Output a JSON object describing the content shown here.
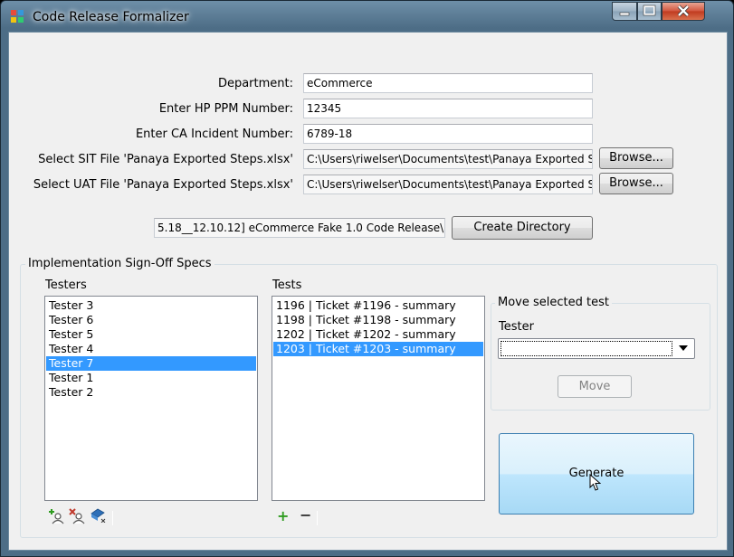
{
  "window": {
    "title": "Code Release Formalizer"
  },
  "colors": {
    "selection": "#3399ff",
    "generate_button": "#bee6fd",
    "add_icon": "#2e9b1f",
    "remove_icon": "#c0392b"
  },
  "form": {
    "department": {
      "label": "Department:",
      "value": "eCommerce"
    },
    "ppm": {
      "label": "Enter HP PPM Number:",
      "value": "12345"
    },
    "ca": {
      "label": "Enter CA Incident Number:",
      "value": "6789-18"
    },
    "sit": {
      "label": "Select SIT File 'Panaya Exported Steps.xlsx'",
      "value": "C:\\Users\\riwelser\\Documents\\test\\Panaya Exported S",
      "browse_label": "Browse..."
    },
    "uat": {
      "label": "Select UAT File 'Panaya Exported Steps.xlsx'",
      "value": "C:\\Users\\riwelser\\Documents\\test\\Panaya Exported S",
      "browse_label": "Browse..."
    },
    "directory": {
      "value": "5.18__12.10.12] eCommerce Fake 1.0 Code Release\\",
      "button_label": "Create Directory"
    }
  },
  "signoff": {
    "group_title": "Implementation Sign-Off Specs",
    "testers": {
      "label": "Testers",
      "items": [
        "Tester 3",
        "Tester 6",
        "Tester 5",
        "Tester 4",
        "Tester 7",
        "Tester 1",
        "Tester 2"
      ],
      "selected": "Tester 7"
    },
    "tests": {
      "label": "Tests",
      "items": [
        "1196 | Ticket #1196 - summary",
        "1198 | Ticket #1198 - summary",
        "1202 | Ticket #1202 - summary",
        "1203 | Ticket #1203 - summary"
      ],
      "selected": "1203 | Ticket #1203 - summary"
    },
    "move_group": {
      "title": "Move selected test",
      "tester_label": "Tester",
      "tester_value": "",
      "move_label": "Move"
    },
    "generate_label": "Generate",
    "tester_toolbar": [
      "add-user-icon",
      "remove-user-icon",
      "clear-users-icon"
    ],
    "test_toolbar": {
      "add": "+",
      "remove": "−"
    }
  }
}
